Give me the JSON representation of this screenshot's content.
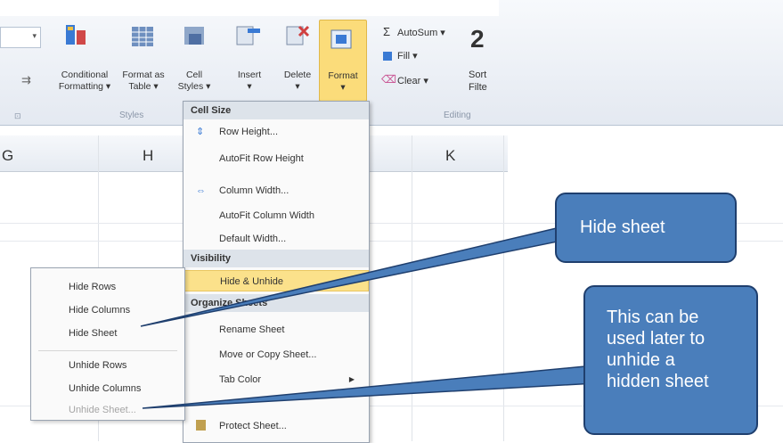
{
  "ribbon": {
    "buttons": [
      {
        "id": "conditional-formatting",
        "line1": "Conditional",
        "line2": "Formatting ▾"
      },
      {
        "id": "format-as-table",
        "line1": "Format as",
        "line2": "Table ▾"
      },
      {
        "id": "cell-styles",
        "line1": "Cell",
        "line2": "Styles ▾"
      },
      {
        "id": "insert",
        "line1": "Insert",
        "line2": "▾"
      },
      {
        "id": "delete",
        "line1": "Delete",
        "line2": "▾"
      },
      {
        "id": "format",
        "line1": "Format",
        "line2": "▾"
      }
    ],
    "styles_group_label": "Styles",
    "editing_group_label": "Editing",
    "autosum_label": "AutoSum ▾",
    "fill_label": "Fill ▾",
    "clear_label": "Clear ▾",
    "sort_label": "Sort",
    "filter_label": "Filte"
  },
  "columns": [
    "G",
    "H",
    "K"
  ],
  "format_menu": {
    "cell_size_header": "Cell Size",
    "row_height": "Row Height...",
    "autofit_row_height": "AutoFit Row Height",
    "column_width": "Column Width...",
    "autofit_column_width": "AutoFit Column Width",
    "default_width": "Default Width...",
    "visibility_header": "Visibility",
    "hide_unhide": "Hide & Unhide",
    "organize_header": "Organize Sheets",
    "rename_sheet": "Rename Sheet",
    "move_copy": "Move or Copy Sheet...",
    "tab_color": "Tab Color",
    "protect_sheet": "Protect Sheet..."
  },
  "submenu": {
    "hide_rows": "Hide Rows",
    "hide_columns": "Hide Columns",
    "hide_sheet": "Hide Sheet",
    "unhide_rows": "Unhide Rows",
    "unhide_columns": "Unhide Columns",
    "unhide_sheet": "Unhide Sheet..."
  },
  "callouts": {
    "hide_sheet": "Hide sheet",
    "unhide_line1": "This can be",
    "unhide_line2": "used later to",
    "unhide_line3": "unhide a",
    "unhide_line4": "hidden sheet"
  },
  "colors": {
    "callout_fill": "#4a7ebb",
    "callout_border": "#1f3f6e",
    "highlight": "#fbe18b"
  }
}
